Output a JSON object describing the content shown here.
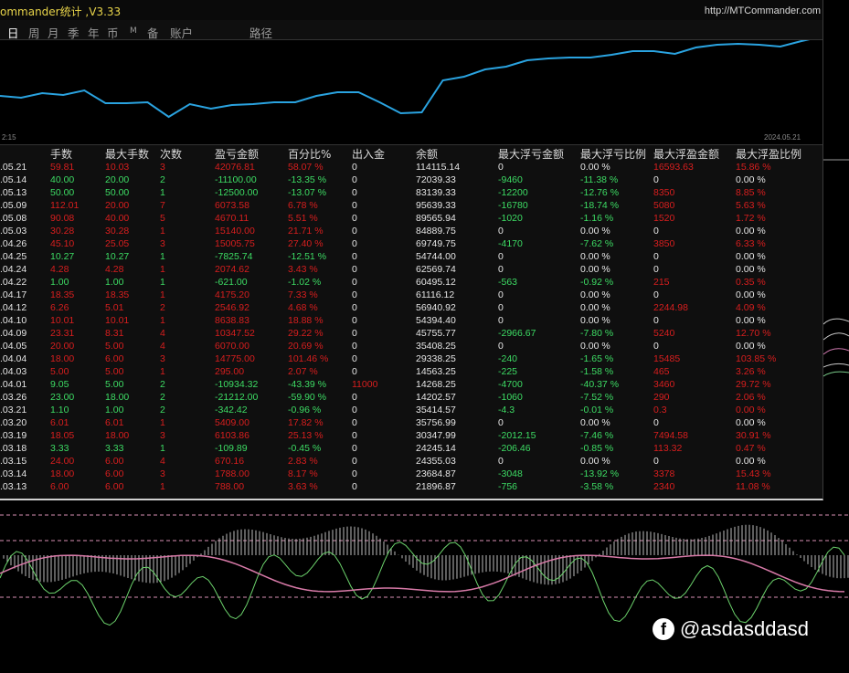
{
  "window": {
    "title": "ommander统计 ,V3.33",
    "website": "http://MTCommander.com"
  },
  "tabs": [
    {
      "label": "日",
      "active": true
    },
    {
      "label": "周",
      "active": false
    },
    {
      "label": "月",
      "active": false
    },
    {
      "label": "季",
      "active": false
    },
    {
      "label": "年",
      "active": false
    },
    {
      "label": "币",
      "active": false
    },
    {
      "label": "M",
      "active": false
    },
    {
      "label": "备",
      "active": false
    },
    {
      "label": "账户",
      "active": false
    },
    {
      "label": "路径",
      "active": false
    }
  ],
  "equity_chart": {
    "start_label": "2:15",
    "end_label": "2024.05.21",
    "line_color": "#2aa3e0",
    "series": [
      104,
      106,
      101,
      103,
      98,
      112,
      112,
      111,
      127,
      113,
      118,
      114,
      113,
      111,
      111,
      104,
      100,
      100,
      111,
      123,
      122,
      87,
      83,
      75,
      72,
      65,
      63,
      62,
      62,
      59,
      55,
      55,
      58,
      51,
      48,
      47,
      48,
      50,
      44,
      39
    ]
  },
  "table": {
    "headers": [
      "手数",
      "最大手数",
      "次数",
      "盈亏金额",
      "百分比%",
      "出入金",
      "余额",
      "最大浮亏金额",
      "最大浮亏比例",
      "最大浮盈金额",
      "最大浮盈比例"
    ],
    "rows": [
      {
        "date": ".05.21",
        "lots": "59.81",
        "max_lots": "10.03",
        "count": "3",
        "pnl": "42076.81",
        "pct": "58.07 %",
        "flow": "0",
        "balance": "114115.14",
        "max_dd": "0",
        "max_dd_pct": "0.00 %",
        "max_fp": "16593.63",
        "max_fp_pct": "15.86 %",
        "sign": "pos"
      },
      {
        "date": ".05.14",
        "lots": "40.00",
        "max_lots": "20.00",
        "count": "2",
        "pnl": "-11100.00",
        "pct": "-13.35 %",
        "flow": "0",
        "balance": "72039.33",
        "max_dd": "-9460",
        "max_dd_pct": "-11.38 %",
        "max_fp": "0",
        "max_fp_pct": "0.00 %",
        "sign": "neg"
      },
      {
        "date": ".05.13",
        "lots": "50.00",
        "max_lots": "50.00",
        "count": "1",
        "pnl": "-12500.00",
        "pct": "-13.07 %",
        "flow": "0",
        "balance": "83139.33",
        "max_dd": "-12200",
        "max_dd_pct": "-12.76 %",
        "max_fp": "8350",
        "max_fp_pct": "8.85 %",
        "sign": "neg"
      },
      {
        "date": ".05.09",
        "lots": "112.01",
        "max_lots": "20.00",
        "count": "7",
        "pnl": "6073.58",
        "pct": "6.78 %",
        "flow": "0",
        "balance": "95639.33",
        "max_dd": "-16780",
        "max_dd_pct": "-18.74 %",
        "max_fp": "5080",
        "max_fp_pct": "5.63 %",
        "sign": "pos"
      },
      {
        "date": ".05.08",
        "lots": "90.08",
        "max_lots": "40.00",
        "count": "5",
        "pnl": "4670.11",
        "pct": "5.51 %",
        "flow": "0",
        "balance": "89565.94",
        "max_dd": "-1020",
        "max_dd_pct": "-1.16 %",
        "max_fp": "1520",
        "max_fp_pct": "1.72 %",
        "sign": "pos"
      },
      {
        "date": ".05.03",
        "lots": "30.28",
        "max_lots": "30.28",
        "count": "1",
        "pnl": "15140.00",
        "pct": "21.71 %",
        "flow": "0",
        "balance": "84889.75",
        "max_dd": "0",
        "max_dd_pct": "0.00 %",
        "max_fp": "0",
        "max_fp_pct": "0.00 %",
        "sign": "pos"
      },
      {
        "date": ".04.26",
        "lots": "45.10",
        "max_lots": "25.05",
        "count": "3",
        "pnl": "15005.75",
        "pct": "27.40 %",
        "flow": "0",
        "balance": "69749.75",
        "max_dd": "-4170",
        "max_dd_pct": "-7.62 %",
        "max_fp": "3850",
        "max_fp_pct": "6.33 %",
        "sign": "pos"
      },
      {
        "date": ".04.25",
        "lots": "10.27",
        "max_lots": "10.27",
        "count": "1",
        "pnl": "-7825.74",
        "pct": "-12.51 %",
        "flow": "0",
        "balance": "54744.00",
        "max_dd": "0",
        "max_dd_pct": "0.00 %",
        "max_fp": "0",
        "max_fp_pct": "0.00 %",
        "sign": "neg"
      },
      {
        "date": ".04.24",
        "lots": "4.28",
        "max_lots": "4.28",
        "count": "1",
        "pnl": "2074.62",
        "pct": "3.43 %",
        "flow": "0",
        "balance": "62569.74",
        "max_dd": "0",
        "max_dd_pct": "0.00 %",
        "max_fp": "0",
        "max_fp_pct": "0.00 %",
        "sign": "pos"
      },
      {
        "date": ".04.22",
        "lots": "1.00",
        "max_lots": "1.00",
        "count": "1",
        "pnl": "-621.00",
        "pct": "-1.02 %",
        "flow": "0",
        "balance": "60495.12",
        "max_dd": "-563",
        "max_dd_pct": "-0.92 %",
        "max_fp": "215",
        "max_fp_pct": "0.35 %",
        "sign": "neg"
      },
      {
        "date": ".04.17",
        "lots": "18.35",
        "max_lots": "18.35",
        "count": "1",
        "pnl": "4175.20",
        "pct": "7.33 %",
        "flow": "0",
        "balance": "61116.12",
        "max_dd": "0",
        "max_dd_pct": "0.00 %",
        "max_fp": "0",
        "max_fp_pct": "0.00 %",
        "sign": "pos"
      },
      {
        "date": ".04.12",
        "lots": "6.26",
        "max_lots": "5.01",
        "count": "2",
        "pnl": "2546.92",
        "pct": "4.68 %",
        "flow": "0",
        "balance": "56940.92",
        "max_dd": "0",
        "max_dd_pct": "0.00 %",
        "max_fp": "2244.98",
        "max_fp_pct": "4.09 %",
        "sign": "pos"
      },
      {
        "date": ".04.10",
        "lots": "10.01",
        "max_lots": "10.01",
        "count": "1",
        "pnl": "8638.83",
        "pct": "18.88 %",
        "flow": "0",
        "balance": "54394.40",
        "max_dd": "0",
        "max_dd_pct": "0.00 %",
        "max_fp": "0",
        "max_fp_pct": "0.00 %",
        "sign": "pos"
      },
      {
        "date": ".04.09",
        "lots": "23.31",
        "max_lots": "8.31",
        "count": "4",
        "pnl": "10347.52",
        "pct": "29.22 %",
        "flow": "0",
        "balance": "45755.77",
        "max_dd": "-2966.67",
        "max_dd_pct": "-7.80 %",
        "max_fp": "5240",
        "max_fp_pct": "12.70 %",
        "sign": "pos"
      },
      {
        "date": ".04.05",
        "lots": "20.00",
        "max_lots": "5.00",
        "count": "4",
        "pnl": "6070.00",
        "pct": "20.69 %",
        "flow": "0",
        "balance": "35408.25",
        "max_dd": "0",
        "max_dd_pct": "0.00 %",
        "max_fp": "0",
        "max_fp_pct": "0.00 %",
        "sign": "pos"
      },
      {
        "date": ".04.04",
        "lots": "18.00",
        "max_lots": "6.00",
        "count": "3",
        "pnl": "14775.00",
        "pct": "101.46 %",
        "flow": "0",
        "balance": "29338.25",
        "max_dd": "-240",
        "max_dd_pct": "-1.65 %",
        "max_fp": "15485",
        "max_fp_pct": "103.85 %",
        "sign": "pos"
      },
      {
        "date": ".04.03",
        "lots": "5.00",
        "max_lots": "5.00",
        "count": "1",
        "pnl": "295.00",
        "pct": "2.07 %",
        "flow": "0",
        "balance": "14563.25",
        "max_dd": "-225",
        "max_dd_pct": "-1.58 %",
        "max_fp": "465",
        "max_fp_pct": "3.26 %",
        "sign": "pos"
      },
      {
        "date": ".04.01",
        "lots": "9.05",
        "max_lots": "5.00",
        "count": "2",
        "pnl": "-10934.32",
        "pct": "-43.39 %",
        "flow": "11000",
        "balance": "14268.25",
        "max_dd": "-4700",
        "max_dd_pct": "-40.37 %",
        "max_fp": "3460",
        "max_fp_pct": "29.72 %",
        "sign": "neg"
      },
      {
        "date": ".03.26",
        "lots": "23.00",
        "max_lots": "18.00",
        "count": "2",
        "pnl": "-21212.00",
        "pct": "-59.90 %",
        "flow": "0",
        "balance": "14202.57",
        "max_dd": "-1060",
        "max_dd_pct": "-7.52 %",
        "max_fp": "290",
        "max_fp_pct": "2.06 %",
        "sign": "neg"
      },
      {
        "date": ".03.21",
        "lots": "1.10",
        "max_lots": "1.00",
        "count": "2",
        "pnl": "-342.42",
        "pct": "-0.96 %",
        "flow": "0",
        "balance": "35414.57",
        "max_dd": "-4.3",
        "max_dd_pct": "-0.01 %",
        "max_fp": "0.3",
        "max_fp_pct": "0.00 %",
        "sign": "neg"
      },
      {
        "date": ".03.20",
        "lots": "6.01",
        "max_lots": "6.01",
        "count": "1",
        "pnl": "5409.00",
        "pct": "17.82 %",
        "flow": "0",
        "balance": "35756.99",
        "max_dd": "0",
        "max_dd_pct": "0.00 %",
        "max_fp": "0",
        "max_fp_pct": "0.00 %",
        "sign": "pos"
      },
      {
        "date": ".03.19",
        "lots": "18.05",
        "max_lots": "18.00",
        "count": "3",
        "pnl": "6103.86",
        "pct": "25.13 %",
        "flow": "0",
        "balance": "30347.99",
        "max_dd": "-2012.15",
        "max_dd_pct": "-7.46 %",
        "max_fp": "7494.58",
        "max_fp_pct": "30.91 %",
        "sign": "pos"
      },
      {
        "date": ".03.18",
        "lots": "3.33",
        "max_lots": "3.33",
        "count": "1",
        "pnl": "-109.89",
        "pct": "-0.45 %",
        "flow": "0",
        "balance": "24245.14",
        "max_dd": "-206.46",
        "max_dd_pct": "-0.85 %",
        "max_fp": "113.32",
        "max_fp_pct": "0.47 %",
        "sign": "neg"
      },
      {
        "date": ".03.15",
        "lots": "24.00",
        "max_lots": "6.00",
        "count": "4",
        "pnl": "670.16",
        "pct": "2.83 %",
        "flow": "0",
        "balance": "24355.03",
        "max_dd": "0",
        "max_dd_pct": "0.00 %",
        "max_fp": "0",
        "max_fp_pct": "0.00 %",
        "sign": "pos"
      },
      {
        "date": ".03.14",
        "lots": "18.00",
        "max_lots": "6.00",
        "count": "3",
        "pnl": "1788.00",
        "pct": "8.17 %",
        "flow": "0",
        "balance": "23684.87",
        "max_dd": "-3048",
        "max_dd_pct": "-13.92 %",
        "max_fp": "3378",
        "max_fp_pct": "15.43 %",
        "sign": "pos"
      },
      {
        "date": ".03.13",
        "lots": "6.00",
        "max_lots": "6.00",
        "count": "1",
        "pnl": "788.00",
        "pct": "3.63 %",
        "flow": "0",
        "balance": "21896.87",
        "max_dd": "-756",
        "max_dd_pct": "-3.58 %",
        "max_fp": "2340",
        "max_fp_pct": "11.08 %",
        "sign": "pos"
      }
    ]
  },
  "watermark": {
    "icon": "facebook-icon",
    "text": "@asdasddasd"
  },
  "colors": {
    "profit": "#d81e1e",
    "loss": "#3ddc64",
    "neutral": "#e6e6e6",
    "title": "#e8d44a"
  }
}
